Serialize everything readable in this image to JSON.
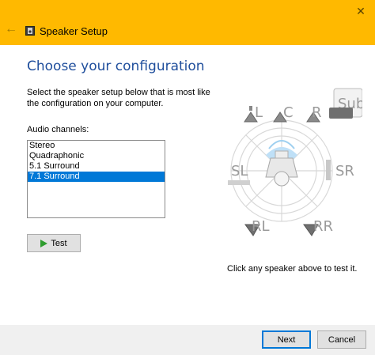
{
  "window": {
    "title": "Speaker Setup",
    "back_icon": "back-arrow-icon",
    "close_icon": "close-icon",
    "accent_color": "#ffb900"
  },
  "main": {
    "heading": "Choose your configuration",
    "instruction": "Select the speaker setup below that is most like the configuration on your computer.",
    "channels_label": "Audio channels:",
    "channels": [
      {
        "label": "Stereo",
        "selected": false
      },
      {
        "label": "Quadraphonic",
        "selected": false
      },
      {
        "label": "5.1 Surround",
        "selected": false
      },
      {
        "label": "7.1 Surround",
        "selected": true
      }
    ],
    "test_label": "Test"
  },
  "diagram": {
    "speakers": {
      "front_left": "L",
      "center": "C",
      "front_right": "R",
      "subwoofer": "Sub",
      "side_left": "SL",
      "side_right": "SR",
      "rear_left": "RL",
      "rear_right": "RR"
    },
    "hint": "Click any speaker above to test it."
  },
  "footer": {
    "next_label": "Next",
    "cancel_label": "Cancel"
  }
}
